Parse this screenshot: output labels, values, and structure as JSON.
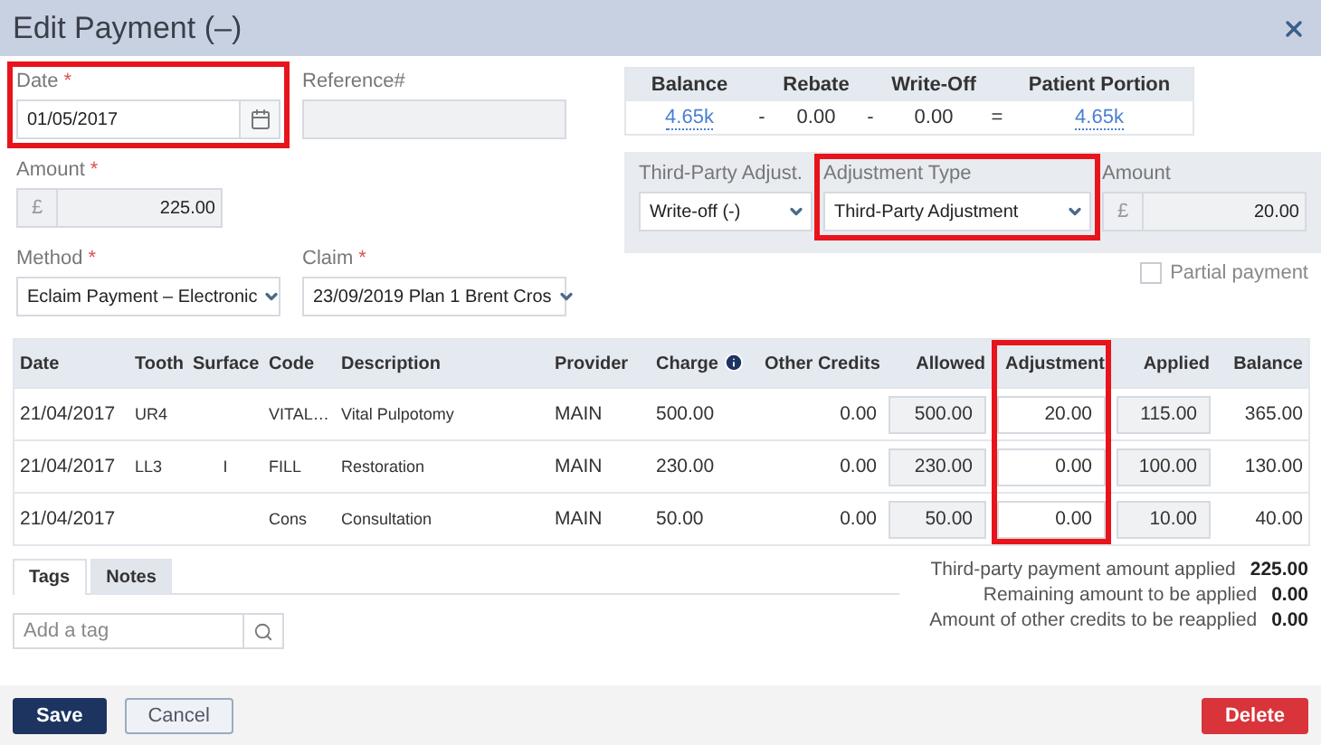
{
  "window": {
    "title": "Edit Payment (–)"
  },
  "date": {
    "label": "Date",
    "required": "*",
    "value": "01/05/2017",
    "highlighted": true
  },
  "reference": {
    "label": "Reference#",
    "disabled": true
  },
  "amount": {
    "label": "Amount",
    "required": "*",
    "currency": "£",
    "value": "225.00"
  },
  "method": {
    "label": "Method",
    "required": "*",
    "value": "Eclaim Payment – Electronic"
  },
  "claim": {
    "label": "Claim",
    "required": "*",
    "value": "23/09/2019 Plan 1 Brent Cros"
  },
  "partial_payment": {
    "label": "Partial payment",
    "checked": false
  },
  "summary": {
    "columns": [
      "Balance",
      "Rebate",
      "Write-Off",
      "Patient Portion"
    ],
    "values": [
      "4.65k",
      "0.00",
      "0.00",
      "4.65k"
    ],
    "operators": [
      "-",
      "-",
      "="
    ]
  },
  "third_party": {
    "adjust": {
      "label": "Third-Party Adjust.",
      "value": "Write-off (-)",
      "highlighted": false
    },
    "adjustment_type": {
      "label": "Adjustment Type",
      "value": "Third-Party Adjustment",
      "highlighted": true
    },
    "amount": {
      "label": "Amount",
      "currency": "£",
      "value": "20.00"
    }
  },
  "table": {
    "columns": [
      {
        "label": "Date",
        "kind": "text",
        "highlighted": false
      },
      {
        "label": "Tooth",
        "kind": "small",
        "highlighted": false
      },
      {
        "label": "Surface",
        "kind": "mark",
        "highlighted": false
      },
      {
        "label": "Code",
        "kind": "small",
        "highlighted": false
      },
      {
        "label": "Description",
        "kind": "small",
        "highlighted": false
      },
      {
        "label": "Provider",
        "kind": "text",
        "highlighted": false
      },
      {
        "label": "Charge",
        "kind": "text",
        "highlighted": false,
        "info": true
      },
      {
        "label": "Other Credits",
        "kind": "number",
        "highlighted": false
      },
      {
        "label": "Allowed",
        "kind": "readonly",
        "highlighted": false
      },
      {
        "label": "Adjustment",
        "kind": "input",
        "highlighted": true
      },
      {
        "label": "Applied",
        "kind": "readonly",
        "highlighted": false
      },
      {
        "label": "Balance",
        "kind": "number",
        "highlighted": false
      }
    ],
    "rows": [
      [
        "21/04/2017",
        "UR4",
        "",
        "VITAL…",
        "Vital Pulpotomy",
        "MAIN",
        "500.00",
        "0.00",
        "500.00",
        "20.00",
        "115.00",
        "365.00"
      ],
      [
        "21/04/2017",
        "LL3",
        "I",
        "FILL",
        "Restoration",
        "MAIN",
        "230.00",
        "0.00",
        "230.00",
        "0.00",
        "100.00",
        "130.00"
      ],
      [
        "21/04/2017",
        "",
        "",
        "Cons",
        "Consultation",
        "MAIN",
        "50.00",
        "0.00",
        "50.00",
        "0.00",
        "10.00",
        "40.00"
      ]
    ]
  },
  "tabs": [
    {
      "label": "Tags",
      "selected": true
    },
    {
      "label": "Notes",
      "selected": false
    }
  ],
  "tag_search": {
    "placeholder": "Add a tag"
  },
  "totals": [
    {
      "label": "Third-party payment amount applied",
      "value": "225.00"
    },
    {
      "label": "Remaining amount to be applied",
      "value": "0.00"
    },
    {
      "label": "Amount of other credits to be reapplied",
      "value": "0.00"
    }
  ],
  "buttons": [
    {
      "label": "Save",
      "kind": "primary"
    },
    {
      "label": "Cancel",
      "kind": "secondary"
    },
    {
      "label": "Delete",
      "kind": "danger"
    }
  ]
}
